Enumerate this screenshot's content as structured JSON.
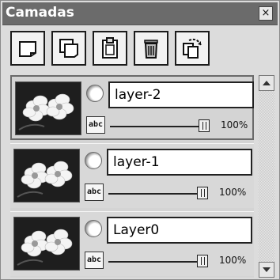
{
  "panel": {
    "title": "Camadas",
    "close_label": "×"
  },
  "toolbar": {
    "buttons": [
      {
        "name": "new-layer-button",
        "icon": "page-icon"
      },
      {
        "name": "duplicate-layer-button",
        "icon": "duplicate-pages-icon"
      },
      {
        "name": "paste-layer-button",
        "icon": "clipboard-icon"
      },
      {
        "name": "delete-layer-button",
        "icon": "trash-icon"
      },
      {
        "name": "layer-properties-button",
        "icon": "rotate-pages-icon"
      }
    ]
  },
  "layers": [
    {
      "name": "layer-2",
      "opacity": "100%",
      "opacity_value": 1.0,
      "selected": true
    },
    {
      "name": "layer-1",
      "opacity": "100%",
      "opacity_value": 1.0,
      "selected": false
    },
    {
      "name": "Layer0",
      "opacity": "100%",
      "opacity_value": 1.0,
      "selected": false
    }
  ],
  "text_icon_label": "abc"
}
